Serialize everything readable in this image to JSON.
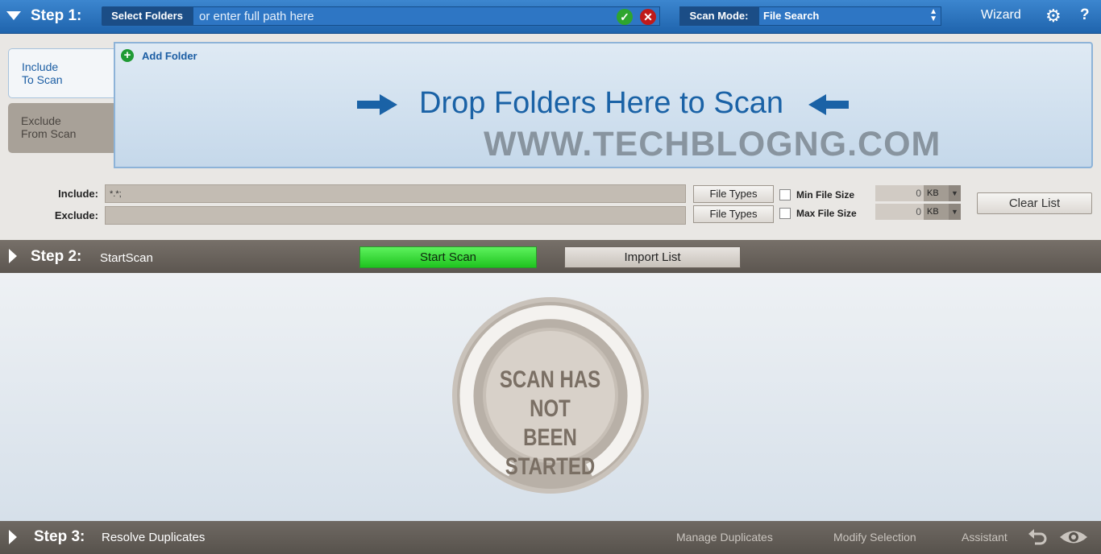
{
  "step1": {
    "title": "Step 1:",
    "select_folders": "Select Folders",
    "path_placeholder": "or enter full path here",
    "scan_mode_label": "Scan Mode:",
    "scan_mode_value": "File Search",
    "wizard": "Wizard",
    "help": "?"
  },
  "tabs": {
    "include": "Include\nTo Scan",
    "exclude": "Exclude\nFrom Scan"
  },
  "dropzone": {
    "add_folder": "Add Folder",
    "drop_text": "Drop Folders Here to Scan",
    "watermark": "WWW.TECHBLOGNG.COM"
  },
  "filters": {
    "include_label": "Include:",
    "include_value": "*.*;",
    "exclude_label": "Exclude:",
    "exclude_value": "",
    "file_types": "File Types",
    "min_size_label": "Min File Size",
    "max_size_label": "Max File Size",
    "min_size_value": "0",
    "max_size_value": "0",
    "unit": "KB",
    "clear_list": "Clear List"
  },
  "step2": {
    "title": "Step 2:",
    "subtitle": "StartScan",
    "start_scan": "Start  Scan",
    "import_list": "Import  List"
  },
  "status": {
    "line1": "SCAN HAS NOT",
    "line2": "BEEN STARTED"
  },
  "step3": {
    "title": "Step 3:",
    "subtitle": "Resolve Duplicates",
    "manage": "Manage Duplicates",
    "modify": "Modify Selection",
    "assistant": "Assistant"
  },
  "colors": {
    "step1_bar": "#2a73bd",
    "start_button": "#3ddc3d",
    "drop_text": "#1a62a6"
  }
}
